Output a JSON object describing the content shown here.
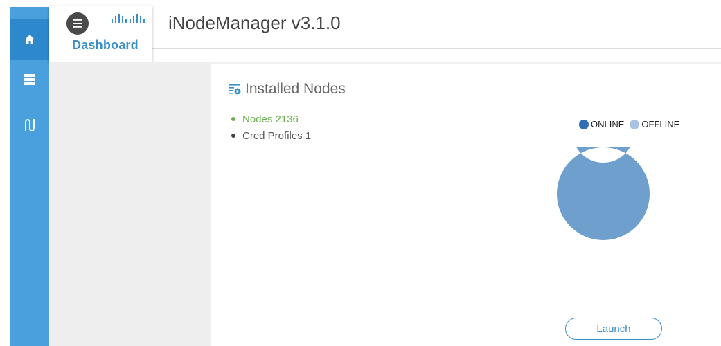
{
  "header": {
    "app_title": "iNodeManager v3.1.0",
    "dashboard_label": "Dashboard",
    "menu_icon": "hamburger-icon",
    "logo": "cisco-logo"
  },
  "sidebar": {
    "items": [
      {
        "name": "home",
        "icon": "home-icon",
        "active": true
      },
      {
        "name": "servers",
        "icon": "server-icon",
        "active": false
      },
      {
        "name": "topology",
        "icon": "topology-icon",
        "active": false
      }
    ],
    "color": "#4aa0dc",
    "active_color": "#2e89cc"
  },
  "installed_nodes": {
    "title": "Installed Nodes",
    "icon": "list-play-icon",
    "stats": [
      {
        "label": "Nodes 2136",
        "color": "#6ab04c"
      },
      {
        "label": "Cred Profiles 1",
        "color": "#555555"
      }
    ],
    "legend": [
      {
        "label": "ONLINE",
        "color": "#2f6eb5"
      },
      {
        "label": "OFFLINE",
        "color": "#a9c1e3"
      }
    ],
    "launch_label": "Launch"
  },
  "chart_data": {
    "type": "pie",
    "variant": "donut",
    "categories": [
      "ONLINE",
      "OFFLINE"
    ],
    "values": [
      0,
      2136
    ],
    "colors": [
      "#2f6eb5",
      "#6f9fcc"
    ]
  }
}
